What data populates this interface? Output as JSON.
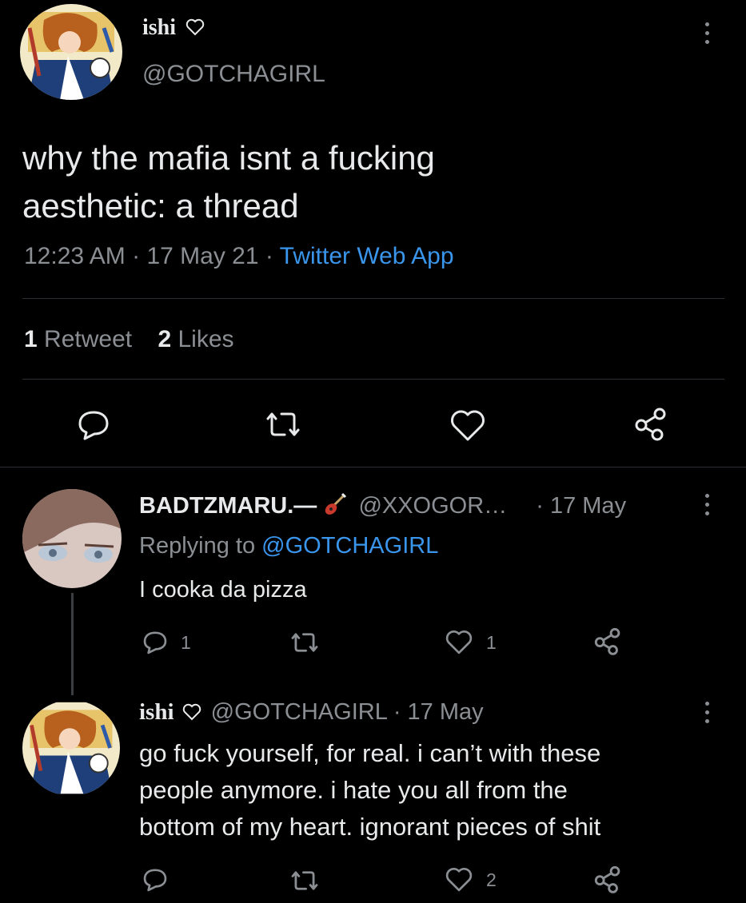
{
  "main_tweet": {
    "display_name": "ishi",
    "handle": "@GOTCHAGIRL",
    "text_line1": "why the mafia isnt a fucking",
    "text_line2": "aesthetic: a thread",
    "time": "12:23 AM",
    "date": "17 May 21",
    "source": "Twitter Web App",
    "retweet_count": "1",
    "retweet_label": "Retweet",
    "like_count": "2",
    "like_label": "Likes"
  },
  "reply1": {
    "display_name": "BADTZMARU.—",
    "handle": "@XXOGOR…",
    "date": "· 17 May",
    "replying_prefix": "Replying to",
    "replying_handle": "@GOTCHAGIRL",
    "text": "I cooka da pizza",
    "reply_count": "1",
    "like_count": "1"
  },
  "reply2": {
    "display_name": "ishi",
    "handle": "@GOTCHAGIRL",
    "date": "· 17 May",
    "text_line1": "go fuck yourself, for real. i can’t with these",
    "text_line2": "people anymore. i hate you all from the",
    "text_line3": "bottom of my heart. ignorant pieces of shit",
    "like_count": "2"
  },
  "icons": {
    "heart_badge": "heart-outline-icon",
    "guitar_emoji": "guitar-icon",
    "reply": "reply-icon",
    "retweet": "retweet-icon",
    "like": "heart-icon",
    "share": "share-icon",
    "more": "more-vertical-icon"
  },
  "colors": {
    "background": "#000000",
    "text": "#e7e9ea",
    "muted": "#8b8f94",
    "link": "#3a96ec"
  }
}
